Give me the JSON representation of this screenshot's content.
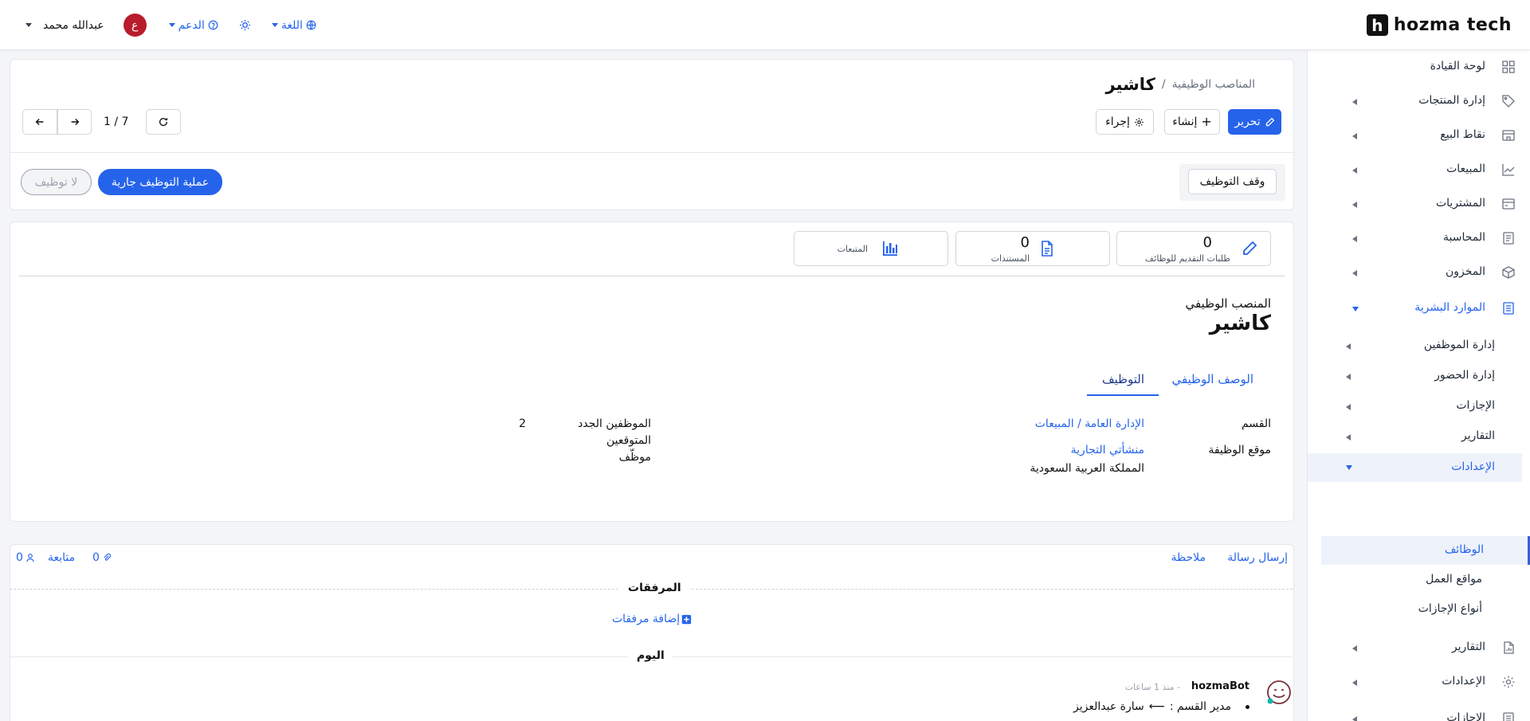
{
  "topbar": {
    "logo_letter": "h",
    "logo_text": "hozma tech",
    "user_name": "عبدالله محمد",
    "avatar_letter": "ع",
    "support_label": "الدعم",
    "language_label": "اللغة"
  },
  "sidebar": {
    "items": [
      {
        "label": "لوحة القيادة"
      },
      {
        "label": "إدارة المنتجات"
      },
      {
        "label": "نقاط البيع"
      },
      {
        "label": "المبيعات"
      },
      {
        "label": "المشتريات"
      },
      {
        "label": "المحاسبة"
      },
      {
        "label": "المخزون"
      },
      {
        "label": "الموارد البشرية"
      }
    ],
    "hr_sub": [
      {
        "label": "إدارة الموظفين"
      },
      {
        "label": "إدارة الحضور"
      },
      {
        "label": "الإجازات"
      },
      {
        "label": "التقارير"
      },
      {
        "label": "الإعدادات"
      }
    ],
    "settings_sub": [
      {
        "label": "الوظائف"
      },
      {
        "label": "مواقع العمل"
      },
      {
        "label": "أنواع الإجازات"
      }
    ],
    "bottom_items": [
      {
        "label": "التقارير"
      },
      {
        "label": "الإعدادات"
      },
      {
        "label": "الإجازات"
      }
    ]
  },
  "breadcrumb": {
    "parent": "المناصب الوظيفية",
    "separator": "/",
    "current": "كاشير"
  },
  "toolbar": {
    "edit_label": "تحرير",
    "create_label": "إنشاء",
    "action_label": "إجراء",
    "pager": "1 / 7"
  },
  "status": {
    "stop_hiring": "وقف التوظيف",
    "hiring_in_progress": "عملية التوظيف جارية",
    "not_hiring": "لا توظيف"
  },
  "stats": [
    {
      "value": "0",
      "label": "طلبات التقديم للوظائف"
    },
    {
      "value": "0",
      "label": "المستندات"
    },
    {
      "value": "",
      "label": "المتبعات"
    }
  ],
  "form": {
    "position_caption": "المنصب الوظيفي",
    "position_name": "كاشير",
    "tabs": [
      "الوصف الوظيفي",
      "التوظيف"
    ],
    "department_label": "القسم",
    "department_value": "الإدارة العامة / المبيعات",
    "location_label": "موقع الوظيفة",
    "location_company": "منشأتي التجارية",
    "location_country": "المملكة العربية السعودية",
    "expected_label_1": "الموظفين الجدد",
    "expected_label_2": "المتوقعين",
    "expected_label_3": "موظّف",
    "expected_value": "2"
  },
  "chatter": {
    "send_message": "إرسال رسالة",
    "note": "ملاحظة",
    "follow": "متابعة",
    "followers_count": "0",
    "attachments_count": "0",
    "attachments_title": "المرفقات",
    "add_attachments": "إضافة مرفقات",
    "today": "اليوم",
    "author": "hozmaBot",
    "time": "- منذ 1 ساعات",
    "message_field": "مدير القسم :",
    "message_value": "سارة عبدالعزيز"
  },
  "colors": {
    "primary": "#2563eb",
    "avatar": "#b91c2c"
  }
}
